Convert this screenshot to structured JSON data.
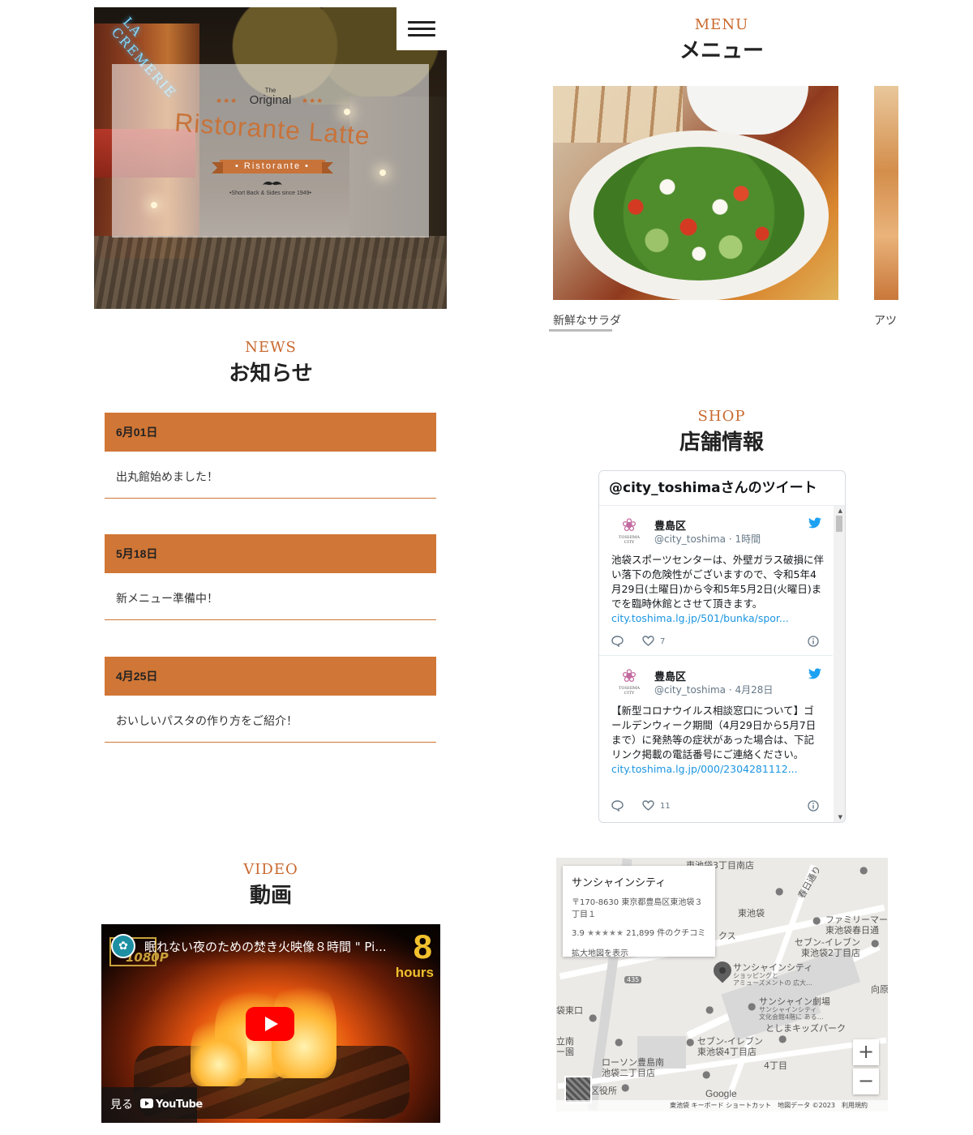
{
  "hero": {
    "sign_text": "LA CREMERIE",
    "logo_the": "The",
    "logo_original": "Original",
    "logo_stars": "★★★",
    "logo_main": "Ristorante Latte",
    "logo_ribbon": "• Ristorante •",
    "logo_since": "•Short Back & Sides since 1949•"
  },
  "news": {
    "en": "NEWS",
    "ja": "お知らせ",
    "items": [
      {
        "date": "6月01日",
        "text": "出丸館始めました！"
      },
      {
        "date": "5月18日",
        "text": "新メニュー準備中！"
      },
      {
        "date": "4月25日",
        "text": "おいしいパスタの作り方をご紹介！"
      }
    ]
  },
  "menu": {
    "en": "MENU",
    "ja": "メニュー",
    "items": [
      {
        "label": "新鮮なサラダ"
      },
      {
        "label": "アツ"
      }
    ]
  },
  "shop": {
    "en": "SHOP",
    "ja": "店舗情報"
  },
  "twitter": {
    "header": "@city_toshimaさんのツイート",
    "tweets": [
      {
        "avatar_text": "TOSHIMA CITY",
        "name": "豊島区",
        "handle": "@city_toshima · 1時間",
        "body": "池袋スポーツセンターは、外壁ガラス破損に伴い落下の危険性がございますので、令和5年4月29日(土曜日)から令和5年5月2日(火曜日)までを臨時休館とさせて頂きます。",
        "link": "city.toshima.lg.jp/501/bunka/spor...",
        "likes": "7"
      },
      {
        "avatar_text": "TOSHIMA CITY",
        "name": "豊島区",
        "handle": "@city_toshima · 4月28日",
        "body": "【新型コロナウイルス相談窓口について】ゴールデンウィーク期間（4月29日から5月7日まで）に発熱等の症状があった場合は、下記リンク掲載の電話番号にご連絡ください。",
        "link": "city.toshima.lg.jp/000/2304281112...",
        "likes": "11"
      }
    ]
  },
  "video": {
    "en": "VIDEO",
    "ja": "動画",
    "tag": "1080P",
    "title": "眠れない夜のための焚き火映像８時間 \" Pi...",
    "hours_num": "8",
    "hours_txt": "hours",
    "watch": "見る",
    "youtube": "YouTube"
  },
  "map": {
    "info_title": "サンシャインシティ",
    "info_addr": "〒170-8630 東京都豊島区東池袋３丁目１",
    "info_rating": "3.9",
    "info_stars": "★★★★★",
    "info_reviews": "21,899 件のクチコミ",
    "info_link": "拡大地図を表示",
    "labels": {
      "top": "東池袋3丁目南店",
      "higashi_ikebukuro": "東池袋",
      "family_mart": "ファミリーマー",
      "family_mart_sub": "東池袋春日通",
      "seven_eleven_1": "セブン-イレブン",
      "seven_eleven_1_sub": "東池袋2丁目店",
      "sunshine_city": "サンシャインシティ",
      "sunshine_city_sub1": "ショッピングと",
      "sunshine_city_sub2": "アミューズメントの 広大…",
      "sunshine_theatre": "サンシャイン劇場",
      "sunshine_theatre_sub1": "サンシャインシティ",
      "sunshine_theatre_sub2": "文化会館4階に ある…",
      "toshimaki": "としまキッズパーク",
      "seven_eleven_2": "セブン-イレブン",
      "seven_eleven_2_sub": "東池袋4丁目店",
      "lawson": "ローソン豊島南",
      "lawson_sub": "池袋二丁目店",
      "yon_chome": "4丁目",
      "kuyakusho": "区役所",
      "route": "435",
      "kasuga": "春日通り",
      "muko": "向原",
      "higashi_guchi": "袋東口",
      "minami": "立南",
      "ku": "クス",
      "minami_en": "ー園"
    },
    "zoom_in": "+",
    "zoom_out": "−",
    "google": "Google",
    "footer": "東池袋 キーボード ショートカット　地図データ ©2023　利用規約"
  },
  "colors": {
    "accent": "#d07636",
    "heading_en": "#c9692f",
    "twitter_blue": "#1da1f2",
    "youtube_red": "#ff0000"
  }
}
